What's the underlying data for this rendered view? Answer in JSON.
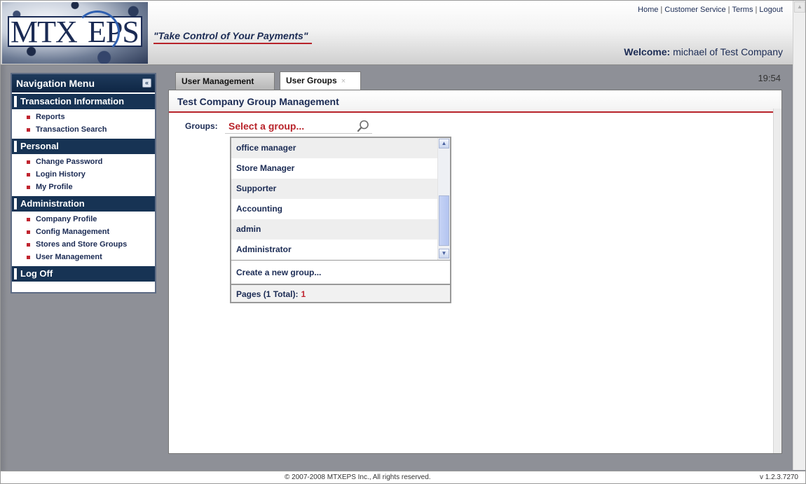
{
  "header": {
    "logo_left": "MTX",
    "logo_right": "EPS",
    "tagline": "\"Take Control of Your Payments\"",
    "links": [
      "Home",
      "Customer Service",
      "Terms",
      "Logout"
    ],
    "welcome_label": "Welcome:",
    "welcome_user": "michael of Test Company"
  },
  "nav": {
    "title": "Navigation Menu",
    "collapse_glyph": "«",
    "sections": [
      {
        "label": "Transaction Information",
        "items": [
          "Reports",
          "Transaction Search"
        ]
      },
      {
        "label": "Personal",
        "items": [
          "Change Password",
          "Login History",
          "My Profile"
        ]
      },
      {
        "label": "Administration",
        "items": [
          "Company Profile",
          "Config Management",
          "Stores and Store Groups",
          "User Management"
        ]
      },
      {
        "label": "Log Off",
        "items": []
      }
    ]
  },
  "tabs": [
    {
      "label": "User Management",
      "active": false
    },
    {
      "label": "User Groups",
      "active": true,
      "close": "×"
    }
  ],
  "clock": "19:54",
  "panel": {
    "title": "Test Company Group Management",
    "groups_label": "Groups:",
    "group_select_value": "Select a group...",
    "group_list": [
      "office manager",
      "Store Manager",
      "Supporter",
      "Accounting",
      "admin",
      "Administrator"
    ],
    "create_label": "Create a new group...",
    "pages_label": "Pages (1 Total):",
    "pages_current": "1"
  },
  "footer": {
    "copyright": "© 2007-2008 MTXEPS Inc., All rights reserved.",
    "version": "v 1.2.3.7270"
  },
  "colors": {
    "navy": "#1b2b54",
    "accent_red": "#b8232a",
    "nav_header": "#173354"
  }
}
